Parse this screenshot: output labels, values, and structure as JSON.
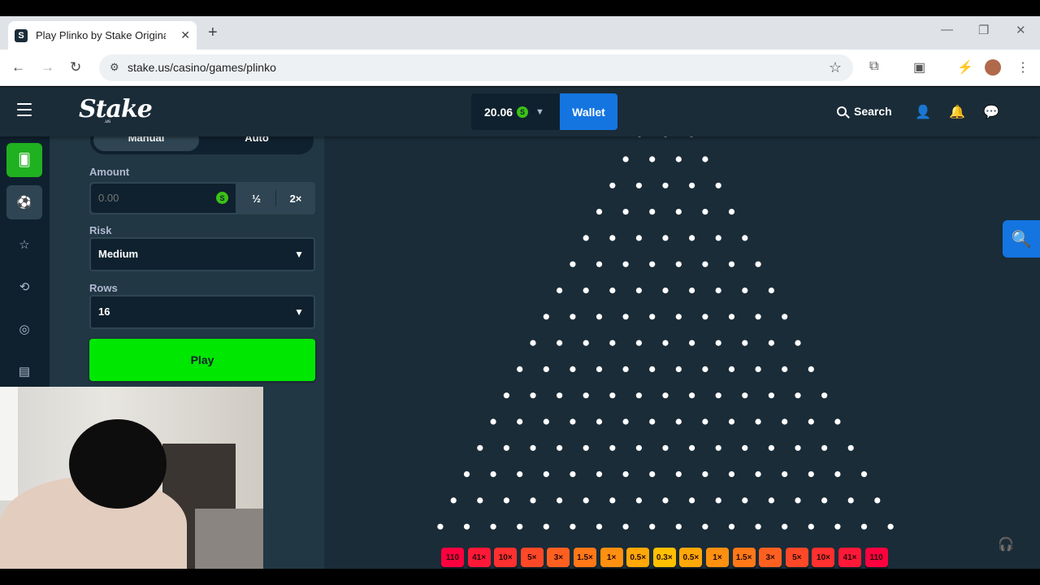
{
  "browser": {
    "tab_title": "Play Plinko by Stake Originals C",
    "favicon": "S",
    "url": "stake.us/casino/games/plinko",
    "newtab_icon": "+",
    "minimize_icon": "—",
    "restore_icon": "❐",
    "close_icon": "✕"
  },
  "header": {
    "logo": "Stake",
    "logo_sub": ".us",
    "balance": "20.06",
    "coin_symbol": "S",
    "wallet_label": "Wallet",
    "search_label": "Search"
  },
  "controls": {
    "mode_manual": "Manual",
    "mode_auto": "Auto",
    "amount_label": "Amount",
    "amount_placeholder": "0.00",
    "half_label": "½",
    "double_label": "2×",
    "risk_label": "Risk",
    "risk_value": "Medium",
    "rows_label": "Rows",
    "rows_value": "16",
    "play_label": "Play"
  },
  "board": {
    "visible_peg_rows": 15,
    "first_visible_row_pegs": 4,
    "buckets": [
      {
        "label": "110",
        "color": "#ff003f"
      },
      {
        "label": "41×",
        "color": "#ff1837"
      },
      {
        "label": "10×",
        "color": "#ff302f"
      },
      {
        "label": "5×",
        "color": "#ff4827"
      },
      {
        "label": "3×",
        "color": "#ff6020"
      },
      {
        "label": "1.5×",
        "color": "#ff7818"
      },
      {
        "label": "1×",
        "color": "#ff9010"
      },
      {
        "label": "0.5×",
        "color": "#ffa808"
      },
      {
        "label": "0.3×",
        "color": "#ffc000"
      },
      {
        "label": "0.5×",
        "color": "#ffa808"
      },
      {
        "label": "1×",
        "color": "#ff9010"
      },
      {
        "label": "1.5×",
        "color": "#ff7818"
      },
      {
        "label": "3×",
        "color": "#ff6020"
      },
      {
        "label": "5×",
        "color": "#ff4827"
      },
      {
        "label": "10×",
        "color": "#ff302f"
      },
      {
        "label": "41×",
        "color": "#ff1837"
      },
      {
        "label": "110",
        "color": "#ff003f"
      }
    ]
  },
  "colors": {
    "accent_green": "#00e701",
    "wallet_blue": "#1475e1",
    "bg_dark": "#1a2c38",
    "panel": "#213743"
  }
}
